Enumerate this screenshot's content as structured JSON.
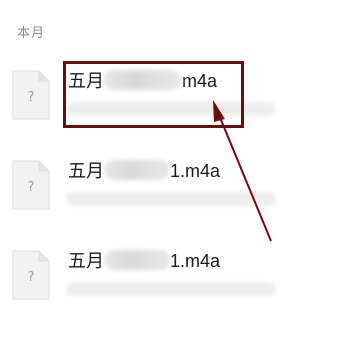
{
  "section": {
    "label": "本月"
  },
  "files": [
    {
      "prefix": "五月",
      "suffix": "m4a",
      "icon": "unknown-file-icon",
      "icon_glyph": "?"
    },
    {
      "prefix": "五月",
      "suffix": "1.m4a",
      "icon": "unknown-file-icon",
      "icon_glyph": "?"
    },
    {
      "prefix": "五月",
      "suffix": "1.m4a",
      "icon": "unknown-file-icon",
      "icon_glyph": "?"
    }
  ],
  "colors": {
    "highlight": "#6b0d0d",
    "arrow": "#6b0d0d",
    "label": "#8c8c8c"
  }
}
